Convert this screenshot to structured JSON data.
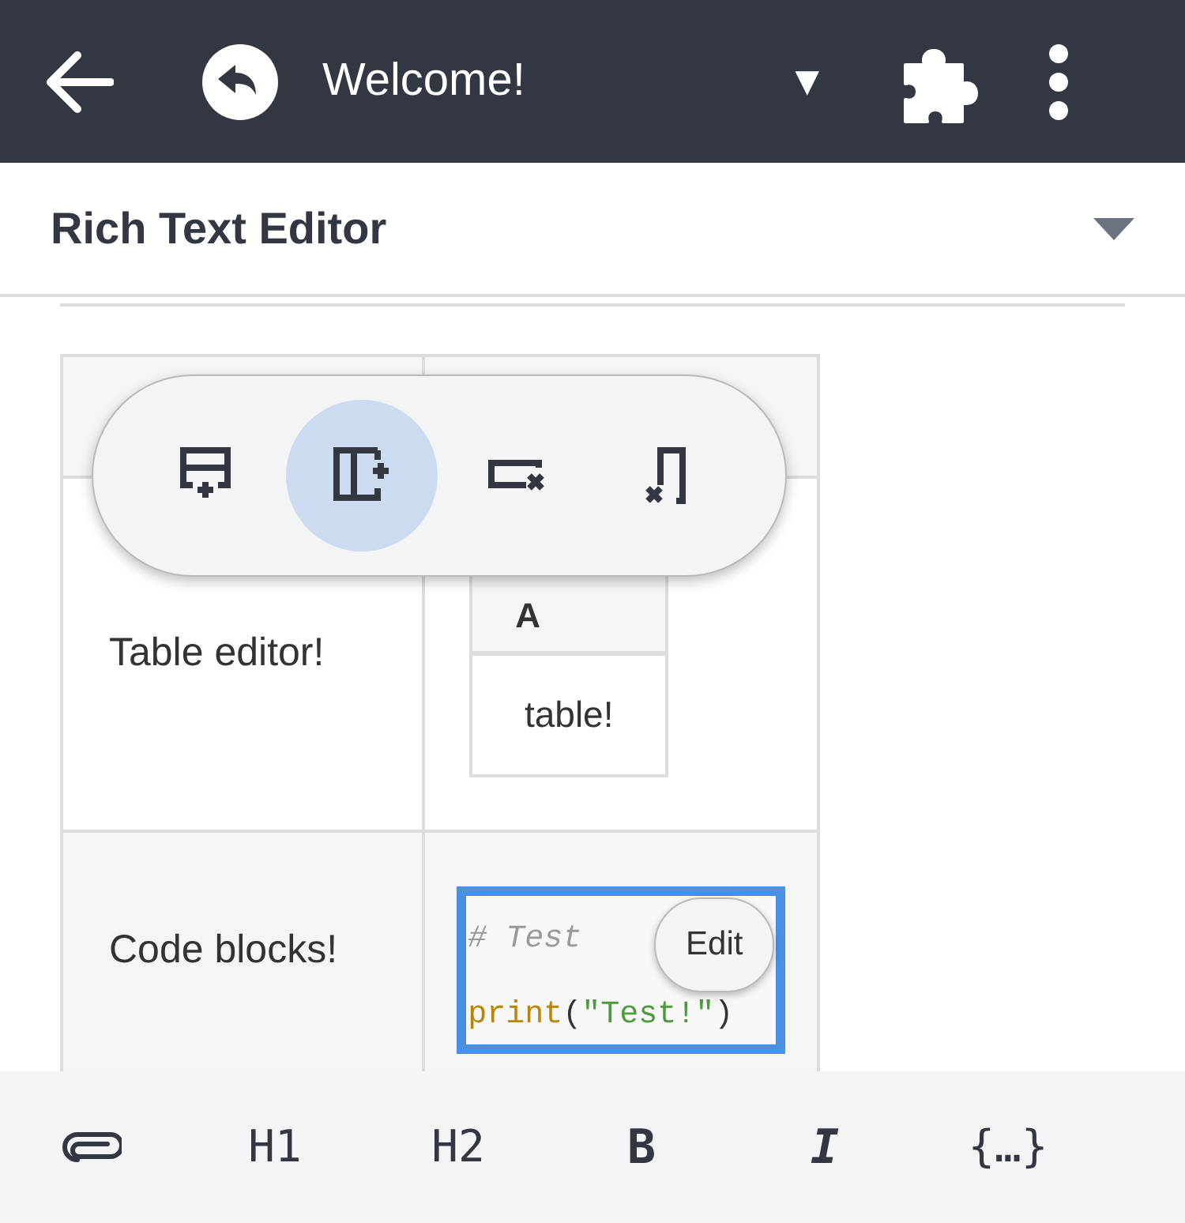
{
  "app_bar": {
    "title": "Welcome!",
    "dropdown": "▼"
  },
  "section": {
    "title": "Rich Text Editor"
  },
  "table": {
    "rows": [
      {
        "label": "Table editor!",
        "content": {
          "kind": "table",
          "header": "A",
          "cell": "table!"
        }
      },
      {
        "label": "Code blocks!",
        "content": {
          "kind": "code",
          "selected": true,
          "edit_label": "Edit",
          "lines": [
            [
              {
                "text": "# Test",
                "kind": "comment"
              }
            ],
            [
              {
                "text": "print",
                "kind": "builtin"
              },
              {
                "text": "(",
                "kind": "punct"
              },
              {
                "text": "\"Test!\"",
                "kind": "string"
              },
              {
                "text": ")",
                "kind": "punct"
              }
            ]
          ]
        }
      }
    ]
  },
  "table_toolbar": [
    {
      "kind": "add-row",
      "selected": false
    },
    {
      "kind": "add-column",
      "selected": true
    },
    {
      "kind": "delete-row",
      "selected": false
    },
    {
      "kind": "delete-column",
      "selected": false
    }
  ],
  "format_bar": [
    {
      "kind": "attach"
    },
    {
      "kind": "text",
      "label": "H1"
    },
    {
      "kind": "text",
      "label": "H2"
    },
    {
      "kind": "bold",
      "label": "B"
    },
    {
      "kind": "italic",
      "label": "I"
    },
    {
      "kind": "text",
      "label": "{…}"
    }
  ]
}
